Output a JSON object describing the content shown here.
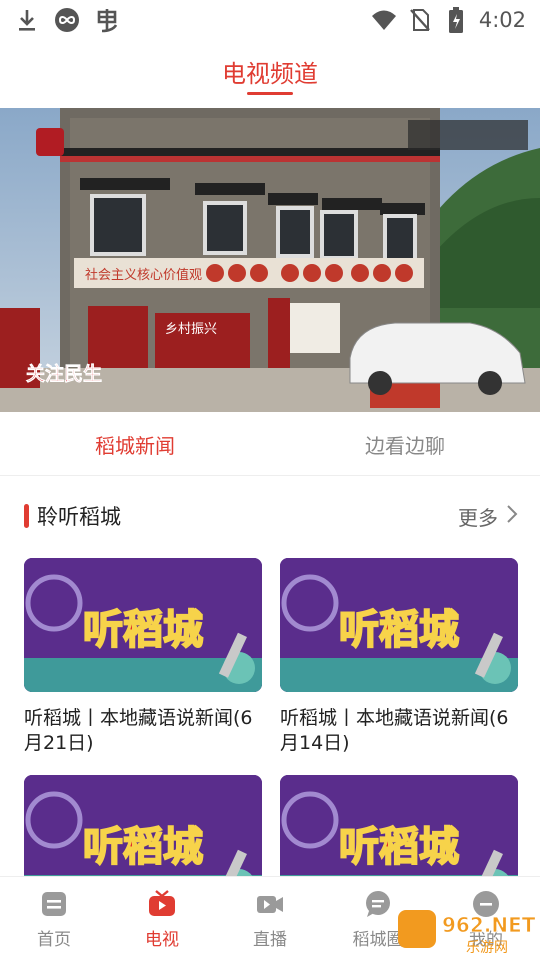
{
  "status_bar": {
    "time": "4:02",
    "left_icons": [
      "download-icon",
      "infinity-icon",
      "app-notification-icon"
    ],
    "right_icons": [
      "wifi-icon",
      "no-sim-icon",
      "battery-icon"
    ]
  },
  "header": {
    "title": "电视频道"
  },
  "banner": {
    "caption": "关注民生",
    "sign_text": "社会主义核心价值观",
    "panel_text": "乡村振兴"
  },
  "subtabs": [
    {
      "label": "稻城新闻",
      "active": true
    },
    {
      "label": "边看边聊",
      "active": false
    }
  ],
  "section": {
    "title": "聆听稻城",
    "more_label": "更多"
  },
  "cards": [
    {
      "title": "听稻城丨本地藏语说新闻(6月21日)",
      "thumb_text": "听稻城"
    },
    {
      "title": "听稻城丨本地藏语说新闻(6月14日)",
      "thumb_text": "听稻城"
    },
    {
      "title": "",
      "thumb_text": "听稻城"
    },
    {
      "title": "",
      "thumb_text": "听稻城"
    }
  ],
  "bottom_nav": [
    {
      "label": "首页",
      "icon": "home-doc-icon",
      "active": false
    },
    {
      "label": "电视",
      "icon": "tv-icon",
      "active": true
    },
    {
      "label": "直播",
      "icon": "video-camera-icon",
      "active": false
    },
    {
      "label": "稻城圈",
      "icon": "chat-bubble-icon",
      "active": false
    },
    {
      "label": "我的",
      "icon": "user-icon",
      "active": false
    }
  ],
  "watermark": {
    "text": "962.NET",
    "sub_text": "乐游网"
  },
  "colors": {
    "accent": "#e03c32",
    "text": "#222222",
    "muted": "#8a8a8a"
  }
}
